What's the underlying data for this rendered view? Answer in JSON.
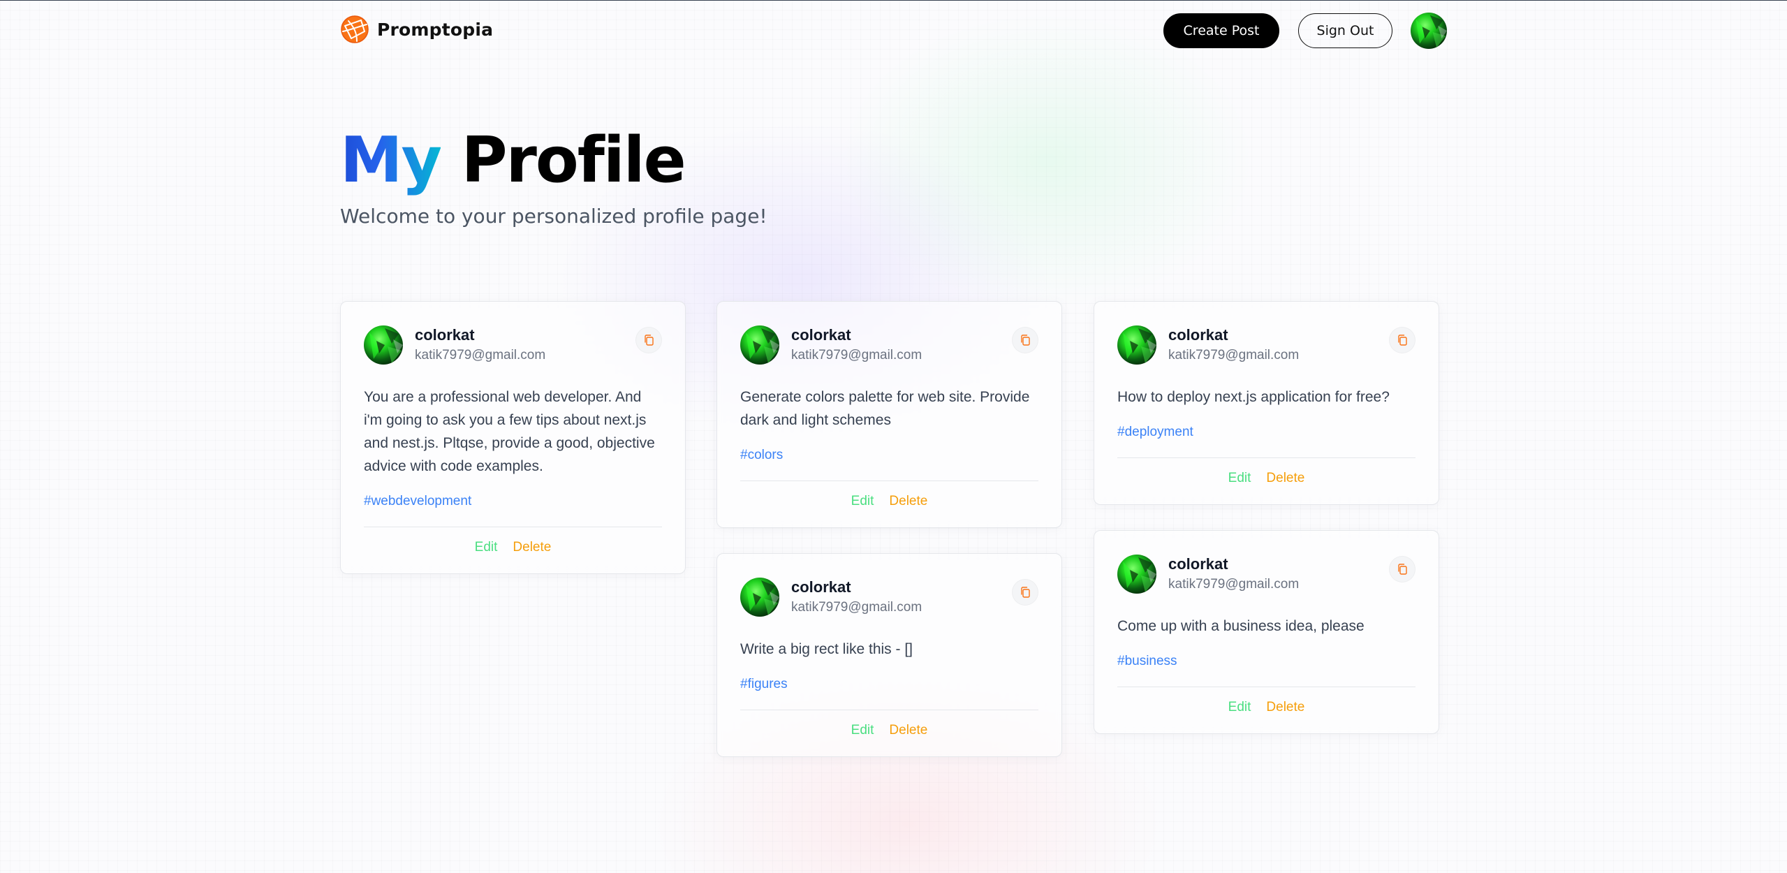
{
  "app": {
    "brand_name": "Promptopia",
    "create_post_label": "Create Post",
    "sign_out_label": "Sign Out"
  },
  "header": {
    "title_accent": "My",
    "title_rest": "Profile",
    "description": "Welcome to your personalized profile page!"
  },
  "colors": {
    "accent_start": "#1d4ed8",
    "accent_end": "#06b6d4",
    "brand_orange": "#f97316",
    "tag_blue": "#3b82f6",
    "edit_green": "#4ade80",
    "delete_orange": "#f59e0b"
  },
  "icons": {
    "logo": "globe-logo-icon",
    "copy": "copy-icon"
  },
  "posts": [
    {
      "username": "colorkat",
      "email": "katik7979@gmail.com",
      "prompt": "You are a professional web developer. And i'm going to ask you a few tips about next.js and nest.js. Pltqse, provide a good, objective advice with code examples.",
      "tag": "#webdevelopment",
      "edit_label": "Edit",
      "delete_label": "Delete"
    },
    {
      "username": "colorkat",
      "email": "katik7979@gmail.com",
      "prompt": "Generate colors palette for web site. Provide dark and light schemes",
      "tag": "#colors",
      "edit_label": "Edit",
      "delete_label": "Delete"
    },
    {
      "username": "colorkat",
      "email": "katik7979@gmail.com",
      "prompt": "Write a big rect like this - []",
      "tag": "#figures",
      "edit_label": "Edit",
      "delete_label": "Delete"
    },
    {
      "username": "colorkat",
      "email": "katik7979@gmail.com",
      "prompt": "How to deploy next.js application for free?",
      "tag": "#deployment",
      "edit_label": "Edit",
      "delete_label": "Delete"
    },
    {
      "username": "colorkat",
      "email": "katik7979@gmail.com",
      "prompt": "Come up with a business idea, please",
      "tag": "#business",
      "edit_label": "Edit",
      "delete_label": "Delete"
    }
  ]
}
